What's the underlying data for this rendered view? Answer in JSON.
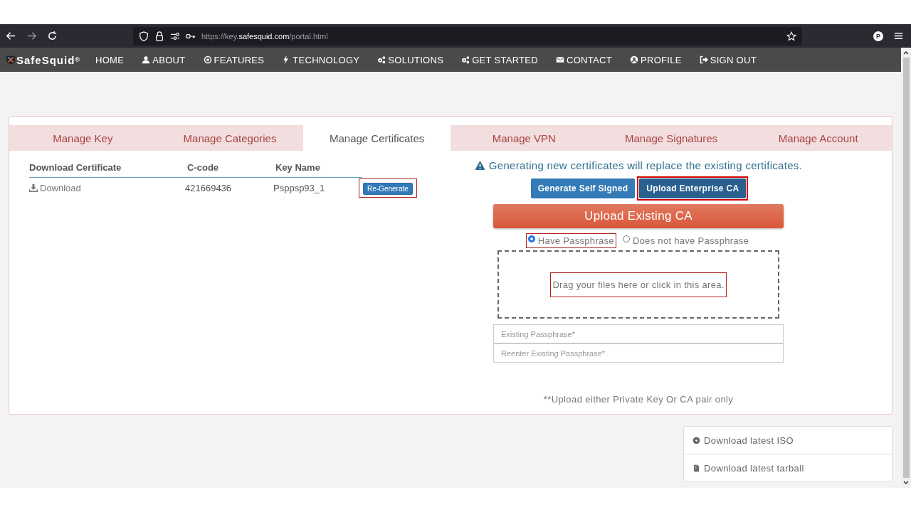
{
  "browser": {
    "url_scheme": "https://key.",
    "url_domain": "safesquid.com",
    "url_path": "/portal.html",
    "profile_initial": "P"
  },
  "nav": {
    "brand": "SafeSquid",
    "brand_mark": "®",
    "items": [
      {
        "label": "HOME",
        "kind": "plain"
      },
      {
        "label": "ABOUT",
        "kind": "user"
      },
      {
        "label": "FEATURES",
        "kind": "target"
      },
      {
        "label": "TECHNOLOGY",
        "kind": "bolt"
      },
      {
        "label": "SOLUTIONS",
        "kind": "gears"
      },
      {
        "label": "GET STARTED",
        "kind": "gears"
      },
      {
        "label": "CONTACT",
        "kind": "envelope"
      },
      {
        "label": "PROFILE",
        "kind": "usercircle"
      },
      {
        "label": "SIGN OUT",
        "kind": "signout"
      }
    ]
  },
  "tabs": [
    {
      "label": "Manage Key",
      "selected": false
    },
    {
      "label": "Manage Categories",
      "selected": false
    },
    {
      "label": "Manage Certificates",
      "selected": true
    },
    {
      "label": "Manage VPN",
      "selected": false
    },
    {
      "label": "Manage Signatures",
      "selected": false
    },
    {
      "label": "Manage Account",
      "selected": false
    }
  ],
  "table": {
    "columns": [
      "Download Certificate",
      "C-code",
      "Key Name"
    ],
    "rows": [
      {
        "download": "Download",
        "c_code": "421669436",
        "key_name": "Psppsp93_1",
        "action": "Re-Generate",
        "action_highlighted": true
      }
    ]
  },
  "warning": "Generating new certificates will replace the existing certificates.",
  "mode_buttons": [
    {
      "label": "Generate Self Signed",
      "selected": false,
      "highlighted": false
    },
    {
      "label": "Upload Enterprise CA",
      "selected": true,
      "highlighted": true
    }
  ],
  "upload_title": "Upload Existing CA",
  "passphrase_options": [
    {
      "label": "Have Passphrase",
      "selected": true,
      "highlighted": true
    },
    {
      "label": "Does not have Passphrase",
      "selected": false,
      "highlighted": false
    }
  ],
  "dropzone": {
    "text": "Drag your files here or click in this area.",
    "highlighted": true
  },
  "fields": [
    {
      "placeholder": "Existing Passphrase*"
    },
    {
      "placeholder": "Reenter Existing Passphrase*"
    }
  ],
  "note": "**Upload either Private Key Or CA pair only",
  "downloads": [
    {
      "label": "Download latest ISO",
      "kind": "disc"
    },
    {
      "label": "Download latest tarball",
      "kind": "file"
    }
  ]
}
